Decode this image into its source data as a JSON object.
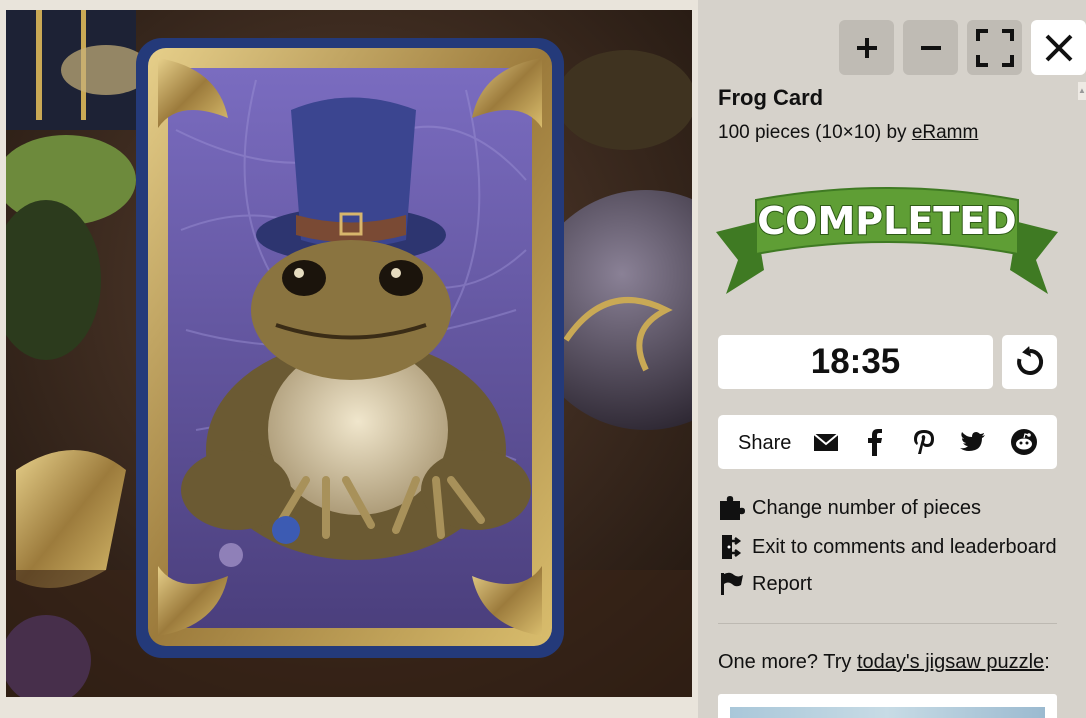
{
  "puzzle": {
    "title": "Frog Card",
    "pieces_text": "100 pieces (10×10) by ",
    "author": "eRamm",
    "status_banner": "COMPLETED",
    "timer": "18:35"
  },
  "controls": {
    "zoom_in_icon": "plus-icon",
    "zoom_out_icon": "minus-icon",
    "fullscreen_icon": "fullscreen-icon",
    "close_icon": "close-icon",
    "restart_icon": "restart-icon"
  },
  "share": {
    "label": "Share",
    "icons": [
      "mail-icon",
      "facebook-icon",
      "pinterest-icon",
      "twitter-icon",
      "reddit-icon"
    ]
  },
  "links": {
    "change_pieces": "Change number of pieces",
    "exit_comments": "Exit to comments and leaderboard",
    "report": "Report"
  },
  "more": {
    "prefix": "One more? Try ",
    "link": "today's jigsaw puzzle",
    "suffix": ":"
  },
  "colors": {
    "panel_bg": "#d6d2cb",
    "page_bg": "#e9e4db",
    "banner_green": "#5f9e35",
    "banner_dark_green": "#3f7a23"
  }
}
